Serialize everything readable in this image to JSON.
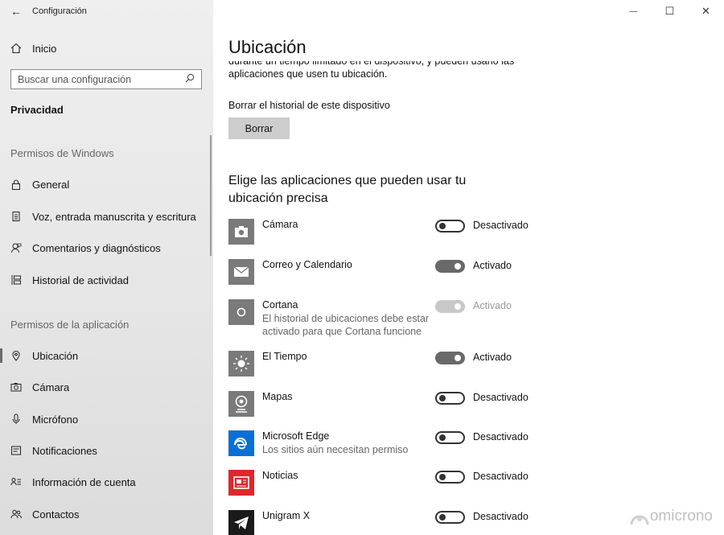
{
  "window": {
    "title": "Configuración",
    "back_glyph": "←",
    "minimize_glyph": "—",
    "maximize_glyph": "☐",
    "close_glyph": "✕"
  },
  "sidebar": {
    "home_label": "Inicio",
    "search_placeholder": "Buscar una configuración",
    "category": "Privacidad",
    "windows_permissions_header": "Permisos de Windows",
    "windows_items": [
      {
        "label": "General",
        "icon": "lock-icon"
      },
      {
        "label": "Voz, entrada manuscrita y escritura",
        "icon": "notepad-icon"
      },
      {
        "label": "Comentarios y diagnósticos",
        "icon": "feedback-icon"
      },
      {
        "label": "Historial de actividad",
        "icon": "timeline-icon"
      }
    ],
    "app_permissions_header": "Permisos de la aplicación",
    "app_items": [
      {
        "label": "Ubicación",
        "icon": "location-icon",
        "active": true
      },
      {
        "label": "Cámara",
        "icon": "camera-icon"
      },
      {
        "label": "Micrófono",
        "icon": "microphone-icon"
      },
      {
        "label": "Notificaciones",
        "icon": "notifications-icon"
      },
      {
        "label": "Información de cuenta",
        "icon": "account-info-icon"
      },
      {
        "label": "Contactos",
        "icon": "contacts-icon"
      }
    ]
  },
  "main": {
    "title": "Ubicación",
    "clipped_text_line1": "durante un tiempo limitado en el dispositivo, y pueden usarlo las",
    "clipped_text_line2": "aplicaciones que usen tu ubicación.",
    "clear_history_label": "Borrar el historial de este dispositivo",
    "clear_button": "Borrar",
    "apps_heading": "Elige las aplicaciones que pueden usar tu ubicación precisa",
    "apps": [
      {
        "name": "Cámara",
        "desc": "",
        "state": "Desactivado",
        "on": false,
        "disabled": false,
        "icon": "camera-app-icon",
        "tile_color": "#7a7a7a"
      },
      {
        "name": "Correo y Calendario",
        "desc": "",
        "state": "Activado",
        "on": true,
        "disabled": false,
        "icon": "mail-app-icon",
        "tile_color": "#7a7a7a"
      },
      {
        "name": "Cortana",
        "desc": "El historial de ubicaciones debe estar activado para que Cortana funcione",
        "state": "Activado",
        "on": true,
        "disabled": true,
        "icon": "cortana-app-icon",
        "tile_color": "#7a7a7a"
      },
      {
        "name": "El Tiempo",
        "desc": "",
        "state": "Activado",
        "on": true,
        "disabled": false,
        "icon": "weather-app-icon",
        "tile_color": "#7a7a7a"
      },
      {
        "name": "Mapas",
        "desc": "",
        "state": "Desactivado",
        "on": false,
        "disabled": false,
        "icon": "maps-app-icon",
        "tile_color": "#7a7a7a"
      },
      {
        "name": "Microsoft Edge",
        "desc": "Los sitios aún necesitan permiso",
        "state": "Desactivado",
        "on": false,
        "disabled": false,
        "icon": "edge-app-icon",
        "tile_color": "#0a6fd6"
      },
      {
        "name": "Noticias",
        "desc": "",
        "state": "Desactivado",
        "on": false,
        "disabled": false,
        "icon": "news-app-icon",
        "tile_color": "#e0262b"
      },
      {
        "name": "Unigram X",
        "desc": "",
        "state": "Desactivado",
        "on": false,
        "disabled": false,
        "icon": "unigram-app-icon",
        "tile_color": "#1a1a1a"
      }
    ]
  },
  "watermark": "omicrono"
}
